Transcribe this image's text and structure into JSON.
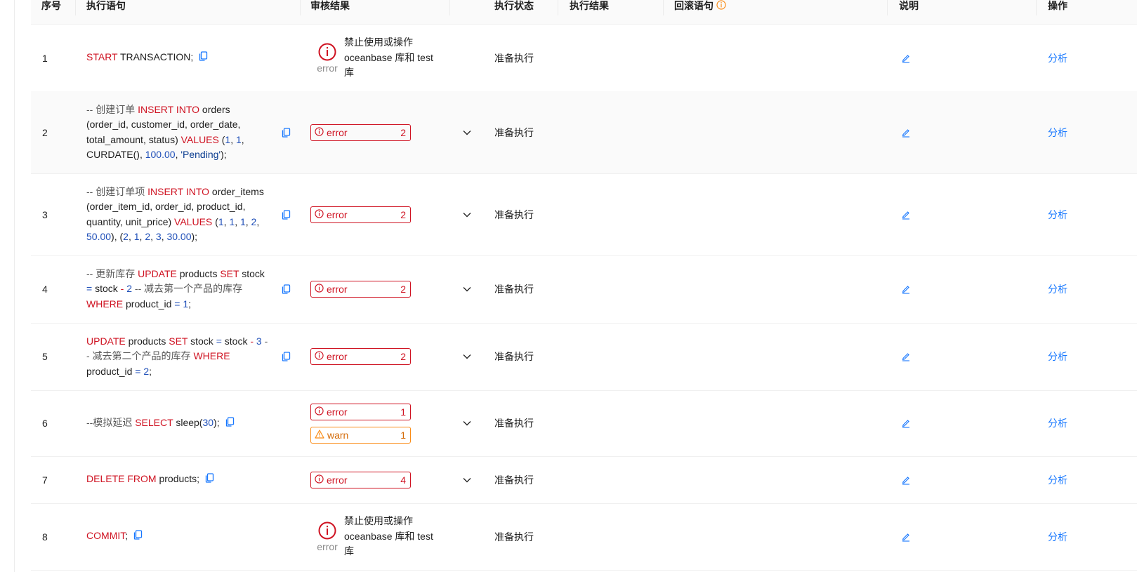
{
  "columns": {
    "seq": "序号",
    "statement": "执行语句",
    "audit": "审核结果",
    "exec_status": "执行状态",
    "exec_result": "执行结果",
    "rollback": "回滚语句",
    "note": "说明",
    "action": "操作"
  },
  "rows": [
    {
      "seq": "1",
      "audit_kind": "block",
      "block_label": "error",
      "block_msg": "禁止使用或操作 oceanbase 库和 test 库",
      "status": "准备执行",
      "action": "分析"
    },
    {
      "seq": "2",
      "audit_kind": "badges",
      "badges": [
        {
          "type": "error",
          "label": "error",
          "count": "2"
        }
      ],
      "status": "准备执行",
      "action": "分析"
    },
    {
      "seq": "3",
      "audit_kind": "badges",
      "badges": [
        {
          "type": "error",
          "label": "error",
          "count": "2"
        }
      ],
      "status": "准备执行",
      "action": "分析"
    },
    {
      "seq": "4",
      "audit_kind": "badges",
      "badges": [
        {
          "type": "error",
          "label": "error",
          "count": "2"
        }
      ],
      "status": "准备执行",
      "action": "分析"
    },
    {
      "seq": "5",
      "audit_kind": "badges",
      "badges": [
        {
          "type": "error",
          "label": "error",
          "count": "2"
        }
      ],
      "status": "准备执行",
      "action": "分析"
    },
    {
      "seq": "6",
      "audit_kind": "badges",
      "badges": [
        {
          "type": "error",
          "label": "error",
          "count": "1"
        },
        {
          "type": "warn",
          "label": "warn",
          "count": "1"
        }
      ],
      "status": "准备执行",
      "action": "分析"
    },
    {
      "seq": "7",
      "audit_kind": "badges",
      "badges": [
        {
          "type": "error",
          "label": "error",
          "count": "4"
        }
      ],
      "status": "准备执行",
      "action": "分析"
    },
    {
      "seq": "8",
      "audit_kind": "block",
      "block_label": "error",
      "block_msg": "禁止使用或操作 oceanbase 库和 test 库",
      "status": "准备执行",
      "action": "分析"
    }
  ],
  "sql": [
    [
      [
        "kw",
        "START"
      ],
      [
        "t",
        " TRANSACTION;"
      ]
    ],
    [
      [
        "cmt",
        "-- 创建订单 "
      ],
      [
        "kw",
        "INSERT INTO"
      ],
      [
        "t",
        " orders (order_id, customer_id, order_date, total_amount, status) "
      ],
      [
        "kw",
        "VALUES"
      ],
      [
        "t",
        " ("
      ],
      [
        "num",
        "1"
      ],
      [
        "t",
        ", "
      ],
      [
        "num",
        "1"
      ],
      [
        "t",
        ", CURDATE(), "
      ],
      [
        "num",
        "100.00"
      ],
      [
        "t",
        ", "
      ],
      [
        "str",
        "'Pending'"
      ],
      [
        "t",
        ");"
      ]
    ],
    [
      [
        "cmt",
        "-- 创建订单项 "
      ],
      [
        "kw",
        "INSERT INTO"
      ],
      [
        "t",
        " order_items (order_item_id, order_id, product_id, quantity, unit_price) "
      ],
      [
        "kw",
        "VALUES"
      ],
      [
        "t",
        " ("
      ],
      [
        "num",
        "1"
      ],
      [
        "t",
        ", "
      ],
      [
        "num",
        "1"
      ],
      [
        "t",
        ", "
      ],
      [
        "num",
        "1"
      ],
      [
        "t",
        ", "
      ],
      [
        "num",
        "2"
      ],
      [
        "t",
        ", "
      ],
      [
        "num",
        "50.00"
      ],
      [
        "t",
        "), ("
      ],
      [
        "num",
        "2"
      ],
      [
        "t",
        ", "
      ],
      [
        "num",
        "1"
      ],
      [
        "t",
        ", "
      ],
      [
        "num",
        "2"
      ],
      [
        "t",
        ", "
      ],
      [
        "num",
        "3"
      ],
      [
        "t",
        ", "
      ],
      [
        "num",
        "30.00"
      ],
      [
        "t",
        ");"
      ]
    ],
    [
      [
        "cmt",
        "-- 更新库存 "
      ],
      [
        "kw",
        "UPDATE"
      ],
      [
        "t",
        " products "
      ],
      [
        "kw",
        "SET"
      ],
      [
        "t",
        " stock "
      ],
      [
        "num",
        "="
      ],
      [
        "t",
        " stock "
      ],
      [
        "kw",
        "-"
      ],
      [
        "t",
        " "
      ],
      [
        "num",
        "2"
      ],
      [
        "cmt",
        " -- 减去第一个产品的库存 "
      ],
      [
        "kw",
        "WHERE"
      ],
      [
        "t",
        " product_id "
      ],
      [
        "num",
        "="
      ],
      [
        "t",
        " "
      ],
      [
        "num",
        "1"
      ],
      [
        "t",
        ";"
      ]
    ],
    [
      [
        "kw",
        "UPDATE"
      ],
      [
        "t",
        " products "
      ],
      [
        "kw",
        "SET"
      ],
      [
        "t",
        " stock "
      ],
      [
        "num",
        "="
      ],
      [
        "t",
        " stock "
      ],
      [
        "kw",
        "-"
      ],
      [
        "t",
        " "
      ],
      [
        "num",
        "3"
      ],
      [
        "cmt",
        " -- 减去第二个产品的库存 "
      ],
      [
        "kw",
        "WHERE"
      ],
      [
        "t",
        " product_id "
      ],
      [
        "num",
        "="
      ],
      [
        "t",
        " "
      ],
      [
        "num",
        "2"
      ],
      [
        "t",
        ";"
      ]
    ],
    [
      [
        "cmt",
        "--模拟延迟 "
      ],
      [
        "kw",
        "SELECT"
      ],
      [
        "t",
        " sleep("
      ],
      [
        "num",
        "30"
      ],
      [
        "t",
        ");"
      ]
    ],
    [
      [
        "kw",
        "DELETE FROM"
      ],
      [
        "t",
        " products;"
      ]
    ],
    [
      [
        "kw",
        "COMMIT"
      ],
      [
        "t",
        ";"
      ]
    ]
  ],
  "colors": {
    "keyword": "#cf1322",
    "number": "#1f4fb8",
    "link": "#1677ff",
    "error": "#cf1322",
    "warn": "#fa8c16"
  },
  "icons": {
    "copy": "copy-icon",
    "expand": "chevron-down-icon",
    "edit": "edit-icon",
    "info": "info-circle-icon",
    "error": "error-circle-icon",
    "warn": "warning-triangle-icon"
  }
}
